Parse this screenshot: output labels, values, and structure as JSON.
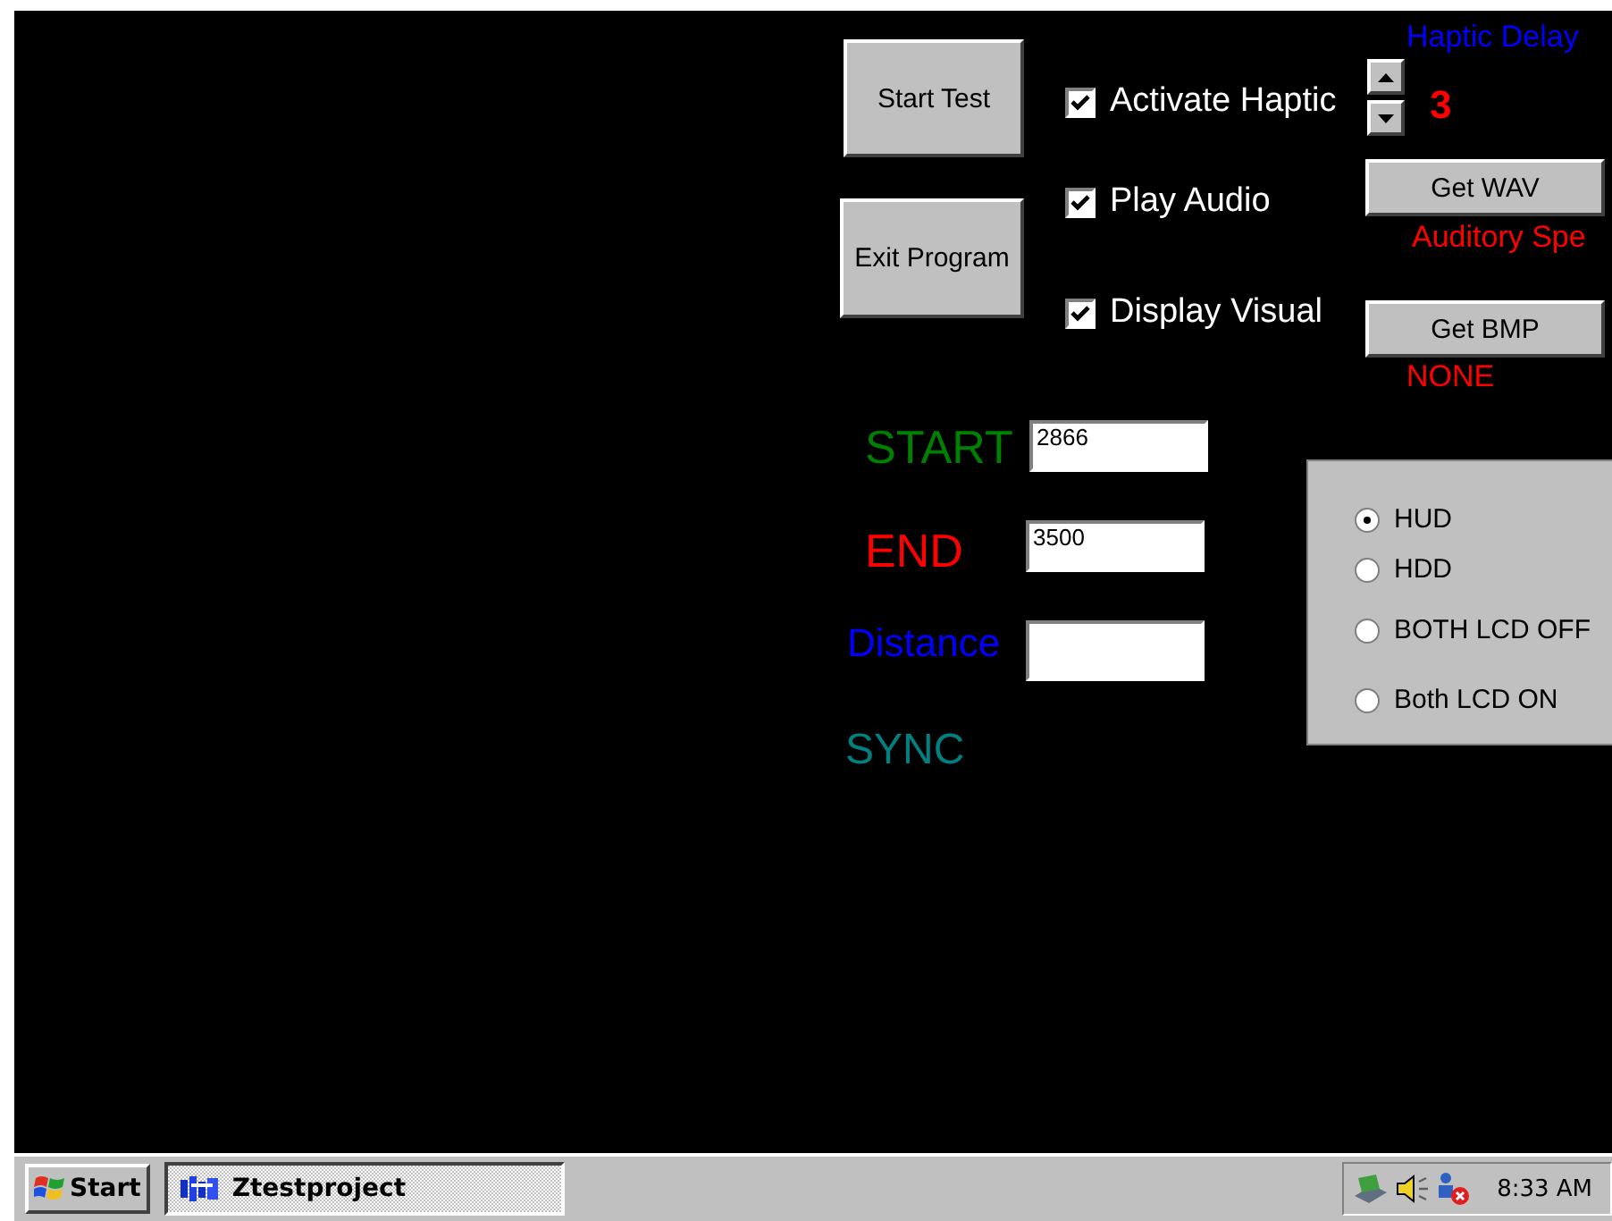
{
  "buttons": [
    {
      "kind": "start_test",
      "label": "Start Test"
    },
    {
      "kind": "exit",
      "label": "Exit Program"
    }
  ],
  "checkboxes": [
    {
      "label": "Activate Haptic",
      "checked": true
    },
    {
      "label": "Play Audio",
      "checked": true
    },
    {
      "label": "Display Visual",
      "checked": true
    }
  ],
  "haptic_delay": {
    "label": "Haptic Delay",
    "value": "3"
  },
  "audio": {
    "button": "Get WAV",
    "file": "Auditory Spe"
  },
  "visual": {
    "button": "Get BMP",
    "file": "NONE"
  },
  "fields": [
    {
      "kind": "start",
      "label": "START",
      "value": "2866",
      "color": "#008000"
    },
    {
      "kind": "end",
      "label": "END",
      "value": "3500",
      "color": "#ff0000"
    },
    {
      "kind": "distance",
      "label": "Distance",
      "color": "#0000ff"
    }
  ],
  "sync": "SYNC",
  "display_modes": [
    {
      "label": "HUD",
      "selected": true
    },
    {
      "label": "HDD",
      "selected": false
    },
    {
      "label": "BOTH LCD OFF",
      "selected": false
    },
    {
      "label": "Both LCD ON",
      "selected": false
    }
  ],
  "taskbar": {
    "start": "Start",
    "task": "Ztestproject",
    "clock": "8:33 AM"
  }
}
